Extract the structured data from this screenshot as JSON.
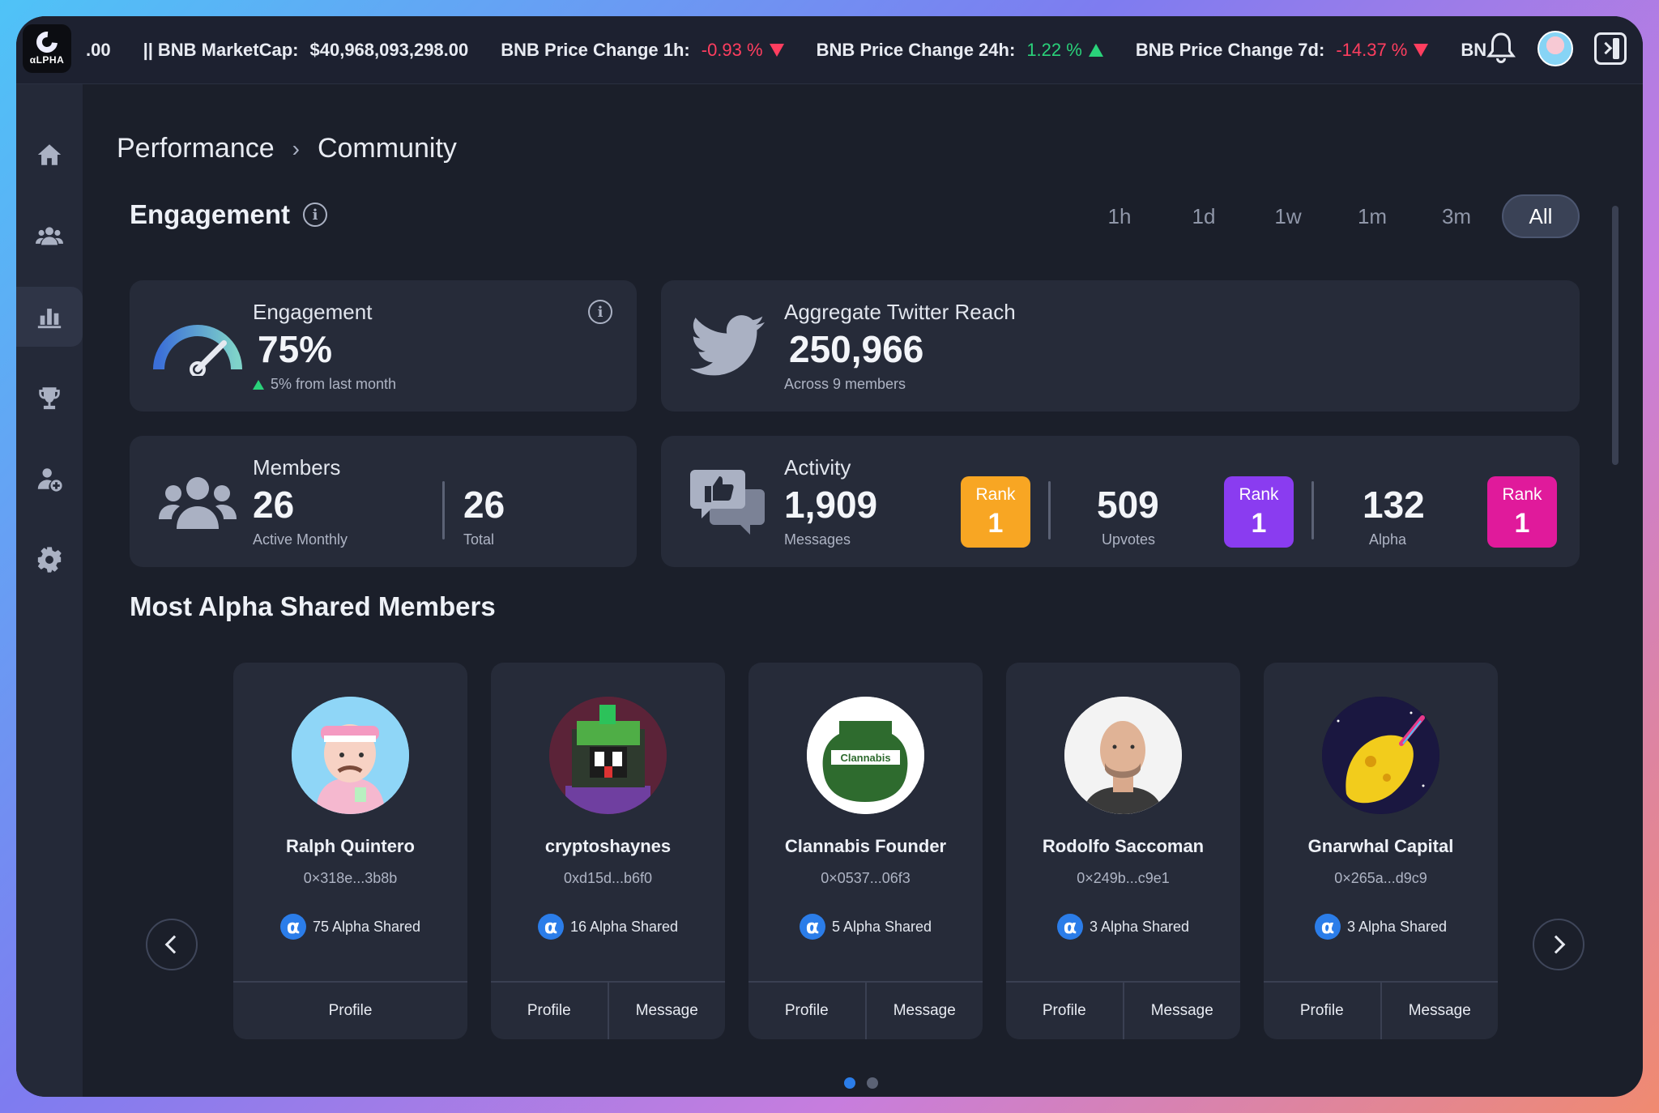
{
  "app": {
    "logo_text": "αLPHA"
  },
  "ticker": {
    "lead": ".00",
    "items": [
      {
        "label": "BNB MarketCap:",
        "value": "$40,968,093,298.00",
        "dir": "none"
      },
      {
        "label": "BNB Price Change 1h:",
        "value": "-0.93 %",
        "dir": "down"
      },
      {
        "label": "BNB Price Change 24h:",
        "value": "1.22 %",
        "dir": "up"
      },
      {
        "label": "BNB Price Change 7d:",
        "value": "-14.37 %",
        "dir": "down"
      }
    ],
    "trail": "BN",
    "colors": {
      "negative": "#ff3e5f",
      "positive": "#2ad27a"
    }
  },
  "sidebar": {
    "items": [
      {
        "name": "home-icon"
      },
      {
        "name": "community-icon"
      },
      {
        "name": "performance-icon",
        "active": true
      },
      {
        "name": "trophy-icon"
      },
      {
        "name": "add-user-icon"
      },
      {
        "name": "gear-icon"
      }
    ]
  },
  "breadcrumb": {
    "parent": "Performance",
    "separator": "›",
    "current": "Community"
  },
  "engagement": {
    "title": "Engagement",
    "ranges": [
      "1h",
      "1d",
      "1w",
      "1m",
      "3m",
      "All"
    ],
    "active_range": "All",
    "gauge": {
      "label": "Engagement",
      "value": "75%",
      "gauge_level": 0.75,
      "change": "5% from last month"
    },
    "twitter": {
      "label": "Aggregate Twitter Reach",
      "value": "250,966",
      "sub": "Across 9 members"
    },
    "members": {
      "label": "Members",
      "active_value": "26",
      "active_label": "Active Monthly",
      "total_value": "26",
      "total_label": "Total"
    },
    "activity": {
      "label": "Activity",
      "messages_value": "1,909",
      "messages_label": "Messages",
      "upvotes_value": "509",
      "upvotes_label": "Upvotes",
      "alpha_value": "132",
      "alpha_label": "Alpha",
      "rank_label": "Rank",
      "ranks": [
        {
          "value": "1",
          "color": "#f8a623"
        },
        {
          "value": "1",
          "color": "#8a3cf0"
        },
        {
          "value": "1",
          "color": "#e01a9b"
        }
      ]
    }
  },
  "members_section": {
    "title": "Most Alpha Shared Members",
    "alpha_symbol": "α",
    "profile_label": "Profile",
    "message_label": "Message",
    "members": [
      {
        "name": "Ralph Quintero",
        "address": "0×318e...3b8b",
        "alpha": "75 Alpha Shared",
        "message": false
      },
      {
        "name": "cryptoshaynes",
        "address": "0xd15d...b6f0",
        "alpha": "16 Alpha Shared",
        "message": true
      },
      {
        "name": "Clannabis Founder",
        "address": "0×0537...06f3",
        "alpha": "5 Alpha Shared",
        "message": true,
        "logo_text": "Clannabis"
      },
      {
        "name": "Rodolfo Saccoman",
        "address": "0×249b...c9e1",
        "alpha": "3 Alpha Shared",
        "message": true
      },
      {
        "name": "Gnarwhal Capital",
        "address": "0×265a...d9c9",
        "alpha": "3 Alpha Shared",
        "message": true
      }
    ],
    "pagination": {
      "pages": 2,
      "current": 1
    }
  }
}
